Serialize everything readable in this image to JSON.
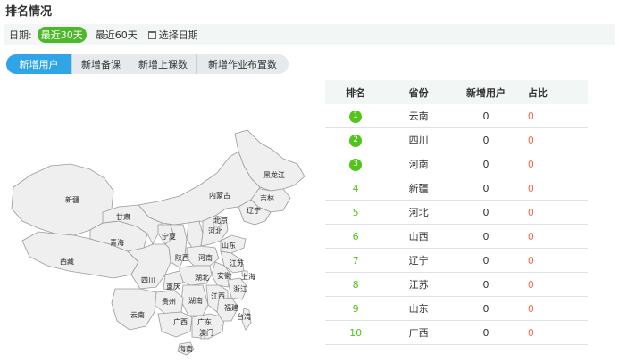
{
  "header": {
    "title": "排名情况"
  },
  "date_filter": {
    "label": "日期:",
    "options": [
      {
        "label": "最近30天",
        "active": true
      },
      {
        "label": "最近60天",
        "active": false
      }
    ],
    "picker_label": "选择日期",
    "accent_color": "#4db82a"
  },
  "tabs": [
    {
      "label": "新增用户",
      "active": true
    },
    {
      "label": "新增备课",
      "active": false
    },
    {
      "label": "新增上课数",
      "active": false
    },
    {
      "label": "新增作业布置数",
      "active": false
    }
  ],
  "map": {
    "provinces": [
      "黑龙江",
      "吉林",
      "辽宁",
      "内蒙古",
      "新疆",
      "甘肃",
      "北京",
      "河北",
      "宁夏",
      "山东",
      "青海",
      "西藏",
      "陕西",
      "河南",
      "江苏",
      "四川",
      "湖北",
      "安徽",
      "上海",
      "重庆",
      "浙江",
      "贵州",
      "湖南",
      "江西",
      "福建",
      "云南",
      "广西",
      "广东",
      "台湾",
      "澳门",
      "海南"
    ]
  },
  "table": {
    "headers": [
      "排名",
      "省份",
      "新增用户",
      "占比"
    ],
    "rows": [
      {
        "rank": "1",
        "province": "云南",
        "users": "0",
        "pct": "0"
      },
      {
        "rank": "2",
        "province": "四川",
        "users": "0",
        "pct": "0"
      },
      {
        "rank": "3",
        "province": "河南",
        "users": "0",
        "pct": "0"
      },
      {
        "rank": "4",
        "province": "新疆",
        "users": "0",
        "pct": "0"
      },
      {
        "rank": "5",
        "province": "河北",
        "users": "0",
        "pct": "0"
      },
      {
        "rank": "6",
        "province": "山西",
        "users": "0",
        "pct": "0"
      },
      {
        "rank": "7",
        "province": "辽宁",
        "users": "0",
        "pct": "0"
      },
      {
        "rank": "8",
        "province": "江苏",
        "users": "0",
        "pct": "0"
      },
      {
        "rank": "9",
        "province": "山东",
        "users": "0",
        "pct": "0"
      },
      {
        "rank": "10",
        "province": "广西",
        "users": "0",
        "pct": "0"
      }
    ],
    "rank_color": "#52c41a",
    "pct_color": "#ef6c4a"
  }
}
